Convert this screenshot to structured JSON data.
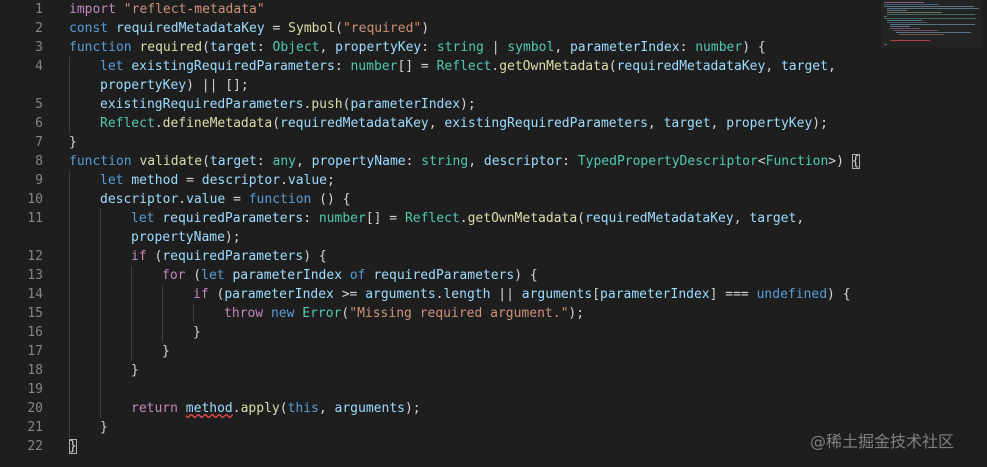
{
  "lines": [
    {
      "n": "1",
      "indent": 0,
      "tokens": [
        [
          "ctrl",
          "import"
        ],
        [
          "pl",
          " "
        ],
        [
          "str",
          "\"reflect-metadata\""
        ]
      ]
    },
    {
      "n": "2",
      "indent": 0,
      "tokens": [
        [
          "kw",
          "const"
        ],
        [
          "pl",
          " "
        ],
        [
          "var",
          "requiredMetadataKey"
        ],
        [
          "pl",
          " = "
        ],
        [
          "fn",
          "Symbol"
        ],
        [
          "pl",
          "("
        ],
        [
          "str",
          "\"required\""
        ],
        [
          "pl",
          ")"
        ]
      ]
    },
    {
      "n": "3",
      "indent": 0,
      "tokens": [
        [
          "kw",
          "function"
        ],
        [
          "pl",
          " "
        ],
        [
          "fn",
          "required"
        ],
        [
          "pl",
          "("
        ],
        [
          "var",
          "target"
        ],
        [
          "pl",
          ": "
        ],
        [
          "type",
          "Object"
        ],
        [
          "pl",
          ", "
        ],
        [
          "var",
          "propertyKey"
        ],
        [
          "pl",
          ": "
        ],
        [
          "type",
          "string"
        ],
        [
          "pl",
          " | "
        ],
        [
          "type",
          "symbol"
        ],
        [
          "pl",
          ", "
        ],
        [
          "var",
          "parameterIndex"
        ],
        [
          "pl",
          ": "
        ],
        [
          "type",
          "number"
        ],
        [
          "pl",
          ") {"
        ]
      ]
    },
    {
      "n": "4",
      "indent": 1,
      "tokens": [
        [
          "kw",
          "let"
        ],
        [
          "pl",
          " "
        ],
        [
          "var",
          "existingRequiredParameters"
        ],
        [
          "pl",
          ": "
        ],
        [
          "type",
          "number"
        ],
        [
          "pl",
          "[] = "
        ],
        [
          "type",
          "Reflect"
        ],
        [
          "pl",
          "."
        ],
        [
          "fn",
          "getOwnMetadata"
        ],
        [
          "pl",
          "("
        ],
        [
          "var",
          "requiredMetadataKey"
        ],
        [
          "pl",
          ", "
        ],
        [
          "var",
          "target"
        ],
        [
          "pl",
          ","
        ]
      ]
    },
    {
      "n": "",
      "indent": 1,
      "tokens": [
        [
          "var",
          "propertyKey"
        ],
        [
          "pl",
          ") || [];"
        ]
      ]
    },
    {
      "n": "5",
      "indent": 1,
      "tokens": [
        [
          "var",
          "existingRequiredParameters"
        ],
        [
          "pl",
          "."
        ],
        [
          "fn",
          "push"
        ],
        [
          "pl",
          "("
        ],
        [
          "var",
          "parameterIndex"
        ],
        [
          "pl",
          ");"
        ]
      ]
    },
    {
      "n": "6",
      "indent": 1,
      "tokens": [
        [
          "type",
          "Reflect"
        ],
        [
          "pl",
          "."
        ],
        [
          "fn",
          "defineMetadata"
        ],
        [
          "pl",
          "("
        ],
        [
          "var",
          "requiredMetadataKey"
        ],
        [
          "pl",
          ", "
        ],
        [
          "var",
          "existingRequiredParameters"
        ],
        [
          "pl",
          ", "
        ],
        [
          "var",
          "target"
        ],
        [
          "pl",
          ", "
        ],
        [
          "var",
          "propertyKey"
        ],
        [
          "pl",
          ");"
        ]
      ]
    },
    {
      "n": "7",
      "indent": 0,
      "tokens": [
        [
          "pl",
          "}"
        ]
      ]
    },
    {
      "n": "8",
      "indent": 0,
      "tokens": [
        [
          "kw",
          "function"
        ],
        [
          "pl",
          " "
        ],
        [
          "fn",
          "validate"
        ],
        [
          "pl",
          "("
        ],
        [
          "var",
          "target"
        ],
        [
          "pl",
          ": "
        ],
        [
          "type",
          "any"
        ],
        [
          "pl",
          ", "
        ],
        [
          "var",
          "propertyName"
        ],
        [
          "pl",
          ": "
        ],
        [
          "type",
          "string"
        ],
        [
          "pl",
          ", "
        ],
        [
          "var",
          "descriptor"
        ],
        [
          "pl",
          ": "
        ],
        [
          "type",
          "TypedPropertyDescriptor"
        ],
        [
          "pl",
          "<"
        ],
        [
          "type",
          "Function"
        ],
        [
          "pl",
          ">) "
        ],
        [
          "bm",
          "{"
        ]
      ]
    },
    {
      "n": "9",
      "indent": 1,
      "tokens": [
        [
          "kw",
          "let"
        ],
        [
          "pl",
          " "
        ],
        [
          "var",
          "method"
        ],
        [
          "pl",
          " = "
        ],
        [
          "var",
          "descriptor"
        ],
        [
          "pl",
          "."
        ],
        [
          "var",
          "value"
        ],
        [
          "pl",
          ";"
        ]
      ]
    },
    {
      "n": "10",
      "indent": 1,
      "tokens": [
        [
          "var",
          "descriptor"
        ],
        [
          "pl",
          "."
        ],
        [
          "var",
          "value"
        ],
        [
          "pl",
          " = "
        ],
        [
          "kw",
          "function"
        ],
        [
          "pl",
          " () {"
        ]
      ]
    },
    {
      "n": "11",
      "indent": 2,
      "tokens": [
        [
          "kw",
          "let"
        ],
        [
          "pl",
          " "
        ],
        [
          "var",
          "requiredParameters"
        ],
        [
          "pl",
          ": "
        ],
        [
          "type",
          "number"
        ],
        [
          "pl",
          "[] = "
        ],
        [
          "type",
          "Reflect"
        ],
        [
          "pl",
          "."
        ],
        [
          "fn",
          "getOwnMetadata"
        ],
        [
          "pl",
          "("
        ],
        [
          "var",
          "requiredMetadataKey"
        ],
        [
          "pl",
          ", "
        ],
        [
          "var",
          "target"
        ],
        [
          "pl",
          ","
        ]
      ]
    },
    {
      "n": "",
      "indent": 2,
      "tokens": [
        [
          "var",
          "propertyName"
        ],
        [
          "pl",
          ");"
        ]
      ]
    },
    {
      "n": "12",
      "indent": 2,
      "tokens": [
        [
          "ctrl",
          "if"
        ],
        [
          "pl",
          " ("
        ],
        [
          "var",
          "requiredParameters"
        ],
        [
          "pl",
          ") {"
        ]
      ]
    },
    {
      "n": "13",
      "indent": 3,
      "tokens": [
        [
          "ctrl",
          "for"
        ],
        [
          "pl",
          " ("
        ],
        [
          "kw",
          "let"
        ],
        [
          "pl",
          " "
        ],
        [
          "var",
          "parameterIndex"
        ],
        [
          "pl",
          " "
        ],
        [
          "kw",
          "of"
        ],
        [
          "pl",
          " "
        ],
        [
          "var",
          "requiredParameters"
        ],
        [
          "pl",
          ") {"
        ]
      ]
    },
    {
      "n": "14",
      "indent": 4,
      "tokens": [
        [
          "ctrl",
          "if"
        ],
        [
          "pl",
          " ("
        ],
        [
          "var",
          "parameterIndex"
        ],
        [
          "pl",
          " >= "
        ],
        [
          "var",
          "arguments"
        ],
        [
          "pl",
          "."
        ],
        [
          "var",
          "length"
        ],
        [
          "pl",
          " || "
        ],
        [
          "var",
          "arguments"
        ],
        [
          "pl",
          "["
        ],
        [
          "var",
          "parameterIndex"
        ],
        [
          "pl",
          "] === "
        ],
        [
          "kw",
          "undefined"
        ],
        [
          "pl",
          ") {"
        ]
      ]
    },
    {
      "n": "15",
      "indent": 5,
      "tokens": [
        [
          "ctrl",
          "throw"
        ],
        [
          "pl",
          " "
        ],
        [
          "kw",
          "new"
        ],
        [
          "pl",
          " "
        ],
        [
          "type",
          "Error"
        ],
        [
          "pl",
          "("
        ],
        [
          "str",
          "\"Missing required argument.\""
        ],
        [
          "pl",
          ");"
        ]
      ]
    },
    {
      "n": "16",
      "indent": 4,
      "tokens": [
        [
          "pl",
          "}"
        ]
      ]
    },
    {
      "n": "17",
      "indent": 3,
      "tokens": [
        [
          "pl",
          "}"
        ]
      ]
    },
    {
      "n": "18",
      "indent": 2,
      "tokens": [
        [
          "pl",
          "}"
        ]
      ]
    },
    {
      "n": "19",
      "indent": 2,
      "tokens": []
    },
    {
      "n": "20",
      "indent": 2,
      "tokens": [
        [
          "ctrl",
          "return"
        ],
        [
          "pl",
          " "
        ],
        [
          "var squig",
          "method"
        ],
        [
          "pl",
          "."
        ],
        [
          "fn",
          "apply"
        ],
        [
          "pl",
          "("
        ],
        [
          "kw",
          "this"
        ],
        [
          "pl",
          ", "
        ],
        [
          "var",
          "arguments"
        ],
        [
          "pl",
          ");"
        ]
      ]
    },
    {
      "n": "21",
      "indent": 1,
      "tokens": [
        [
          "pl",
          "}"
        ]
      ]
    },
    {
      "n": "22",
      "indent": 0,
      "tokens": [
        [
          "bm",
          "}"
        ]
      ]
    }
  ],
  "theme": {
    "background": "#1e1e1e",
    "keyword": "#569cd6",
    "control": "#c586c0",
    "string": "#ce9178",
    "variable": "#9cdcfe",
    "type": "#4ec9b0",
    "function": "#dcdcaa",
    "text": "#d4d4d4",
    "line_number": "#858585"
  },
  "watermark": "@稀土掘金技术社区"
}
